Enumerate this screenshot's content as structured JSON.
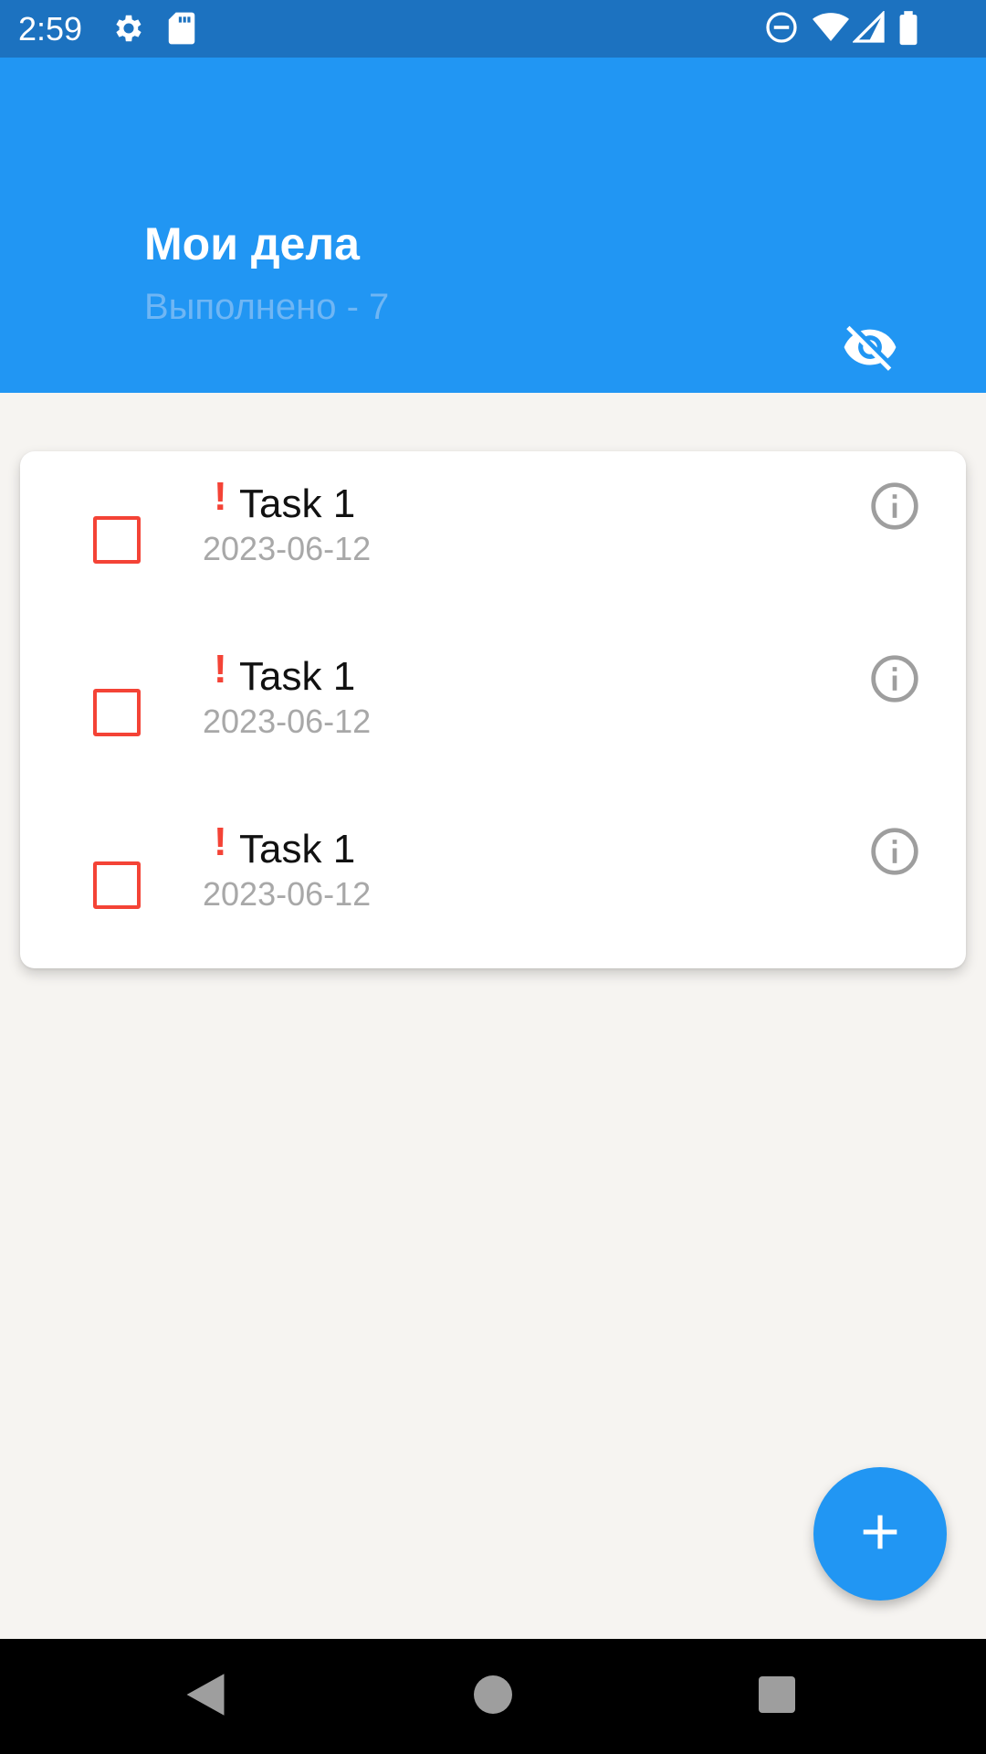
{
  "status_bar": {
    "time": "2:59",
    "icons": [
      "settings-icon",
      "sd-card-icon",
      "do-not-disturb-icon",
      "wifi-icon",
      "signal-icon",
      "battery-icon"
    ]
  },
  "header": {
    "title": "Мои дела",
    "subtitle": "Выполнено - 7",
    "action_icon": "visibility-off-icon"
  },
  "tasks": [
    {
      "priority_mark": "!",
      "title": "Task 1",
      "date": "2023-06-12",
      "checked": false
    },
    {
      "priority_mark": "!",
      "title": "Task 1",
      "date": "2023-06-12",
      "checked": false
    },
    {
      "priority_mark": "!",
      "title": "Task 1",
      "date": "2023-06-12",
      "checked": false
    }
  ],
  "fab": {
    "icon": "add-icon"
  },
  "nav_bar": {
    "buttons": [
      "back-icon",
      "home-icon",
      "recents-icon"
    ]
  },
  "colors": {
    "status_bar": "#1c72c0",
    "app_bar": "#2196f3",
    "background": "#f6f4f1",
    "priority_red": "#f44336",
    "date_gray": "#a8a8a8",
    "subtitle_blue": "#6fb6f4"
  }
}
